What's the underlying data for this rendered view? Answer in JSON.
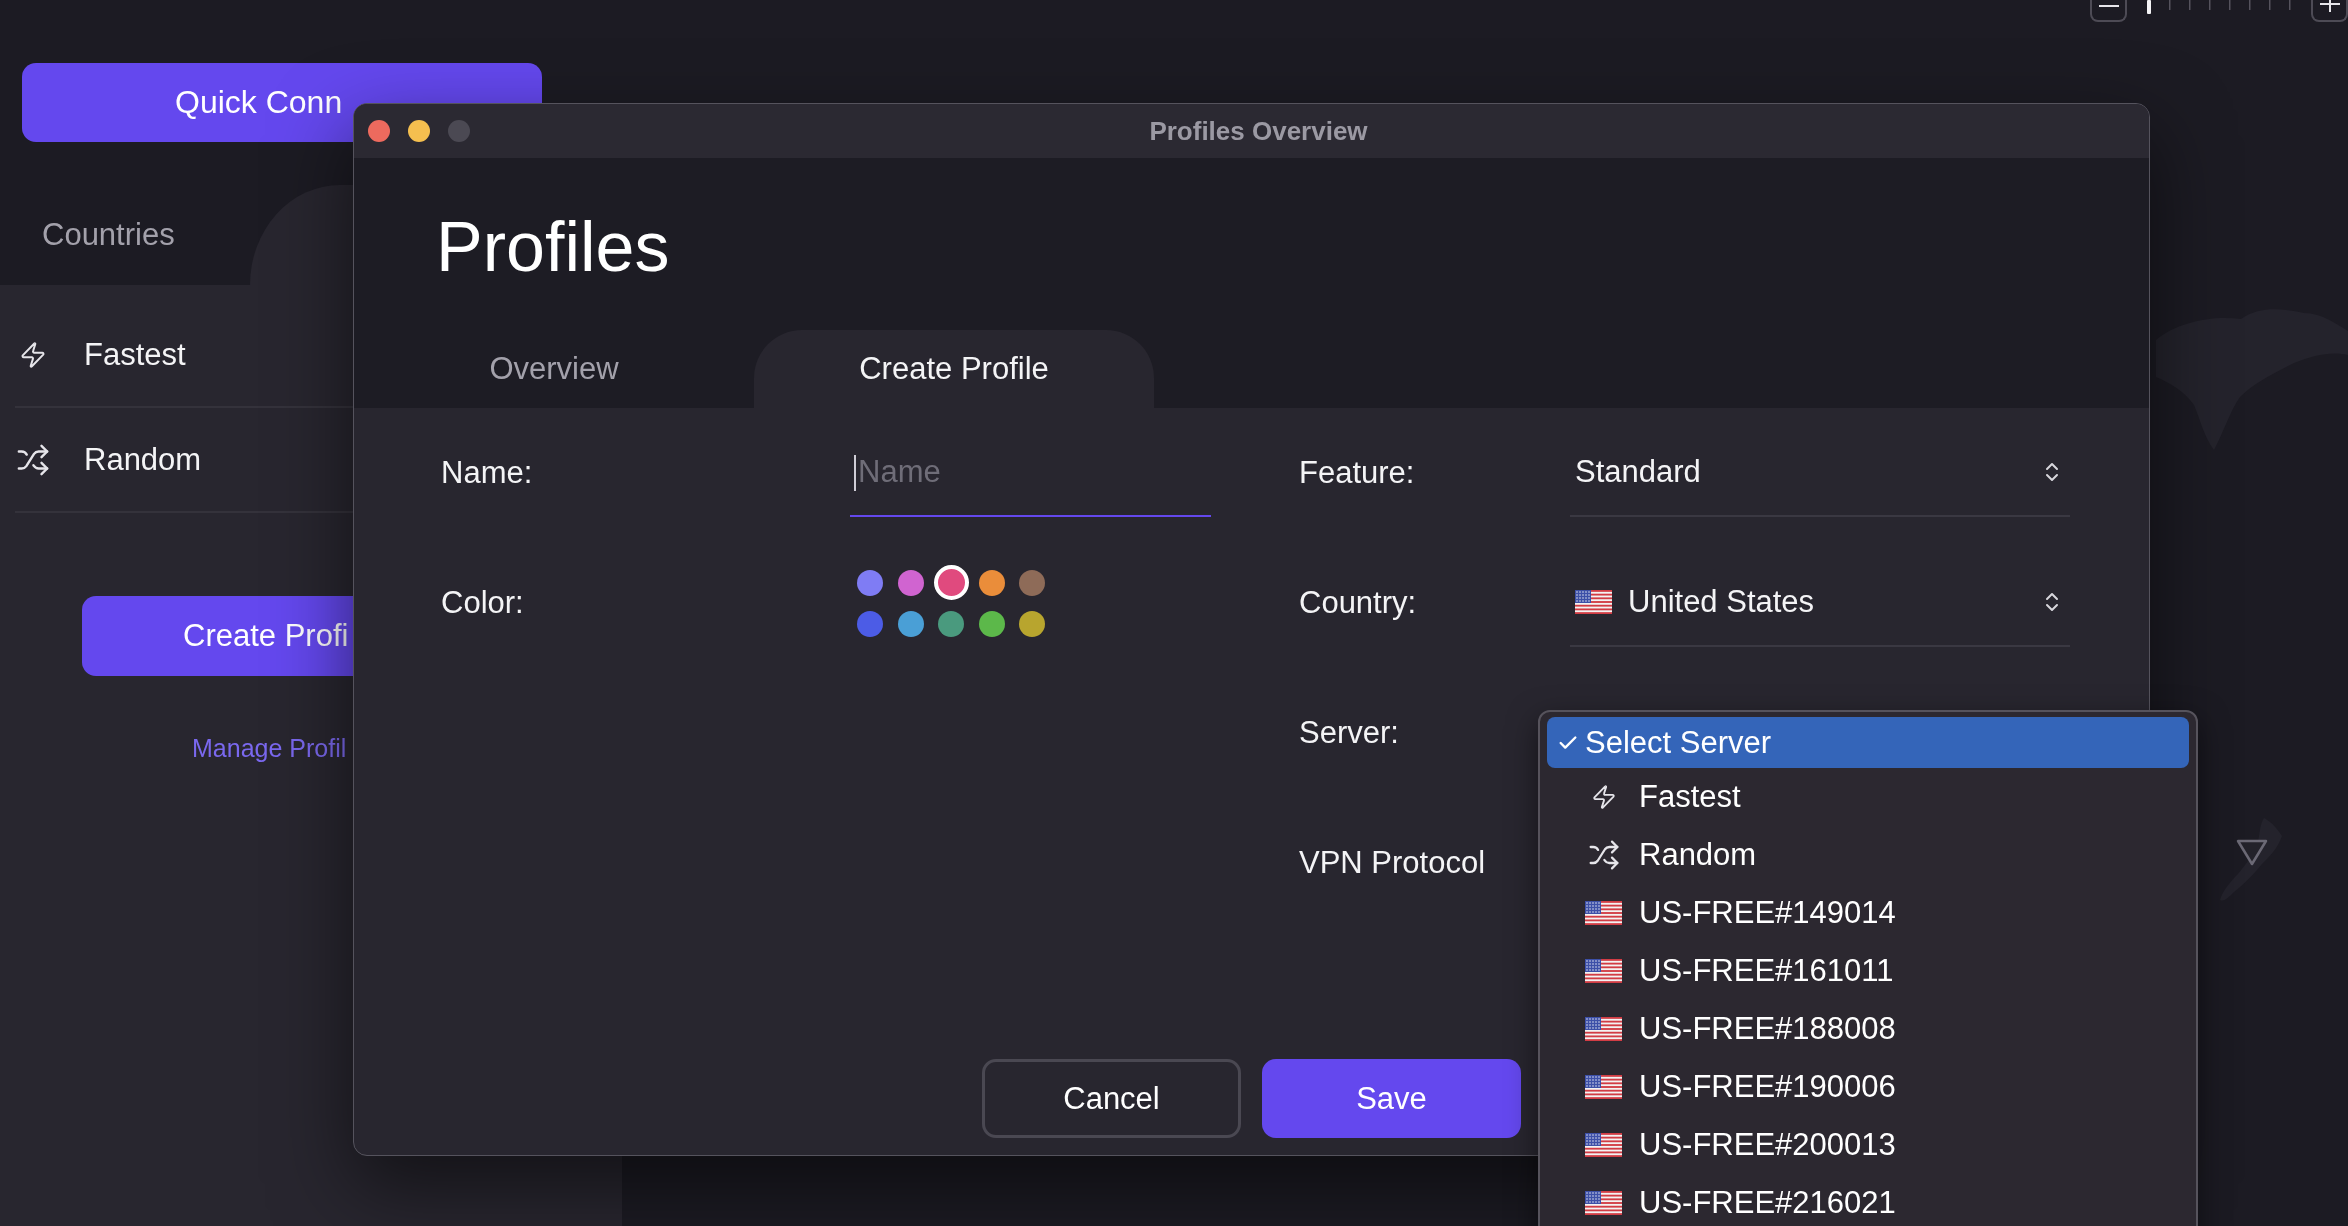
{
  "sidebar": {
    "quick_connect": "Quick Conn",
    "tabs": [
      {
        "label": "Countries",
        "selected": false
      }
    ],
    "items": [
      {
        "kind": "fastest",
        "label": "Fastest"
      },
      {
        "kind": "random",
        "label": "Random"
      }
    ],
    "create_button": "Create Profi",
    "manage_link": "Manage Profil"
  },
  "map": {
    "zoom_slider": {
      "level": 0
    }
  },
  "dialog": {
    "title": "Profiles Overview",
    "window_controls": [
      {
        "kind": "close",
        "disabled": false
      },
      {
        "kind": "minimize",
        "disabled": false
      },
      {
        "kind": "zoom",
        "disabled": true
      }
    ],
    "heading": "Profiles",
    "tabs": [
      {
        "label": "Overview",
        "selected": false
      },
      {
        "label": "Create Profile",
        "selected": true
      }
    ],
    "form": {
      "name": {
        "label": "Name:",
        "placeholder": "Name"
      },
      "color": {
        "label": "Color:",
        "swatches": [
          {
            "color": "#7f7cf4",
            "selected": false
          },
          {
            "color": "#d064d0",
            "selected": false
          },
          {
            "color": "#e04a7e",
            "selected": true
          },
          {
            "color": "#ea8d3a",
            "selected": false
          },
          {
            "color": "#8e6b58",
            "selected": false
          },
          {
            "color": "#4c5ce6",
            "selected": false
          },
          {
            "color": "#4a9fd6",
            "selected": false
          },
          {
            "color": "#4a9a7e",
            "selected": false
          },
          {
            "color": "#5cb84a",
            "selected": false
          },
          {
            "color": "#b8a52e",
            "selected": false
          }
        ]
      },
      "feature": {
        "label": "Feature:",
        "value": "Standard"
      },
      "country": {
        "label": "Country:",
        "value": "United States"
      },
      "server": {
        "label": "Server:"
      },
      "vpn_protocol": {
        "label": "VPN Protocol"
      }
    },
    "buttons": [
      {
        "kind": "secondary",
        "label": "Cancel"
      },
      {
        "kind": "primary",
        "label": "Save"
      }
    ]
  },
  "server_menu": {
    "items": [
      {
        "kind": "placeholder",
        "label": "Select Server",
        "selected": true
      },
      {
        "kind": "fastest",
        "label": "Fastest",
        "selected": false
      },
      {
        "kind": "random",
        "label": "Random",
        "selected": false
      },
      {
        "kind": "server",
        "label": "US-FREE#149014",
        "selected": false
      },
      {
        "kind": "server",
        "label": "US-FREE#161011",
        "selected": false
      },
      {
        "kind": "server",
        "label": "US-FREE#188008",
        "selected": false
      },
      {
        "kind": "server",
        "label": "US-FREE#190006",
        "selected": false
      },
      {
        "kind": "server",
        "label": "US-FREE#200013",
        "selected": false
      },
      {
        "kind": "server",
        "label": "US-FREE#216021",
        "selected": false
      }
    ]
  }
}
